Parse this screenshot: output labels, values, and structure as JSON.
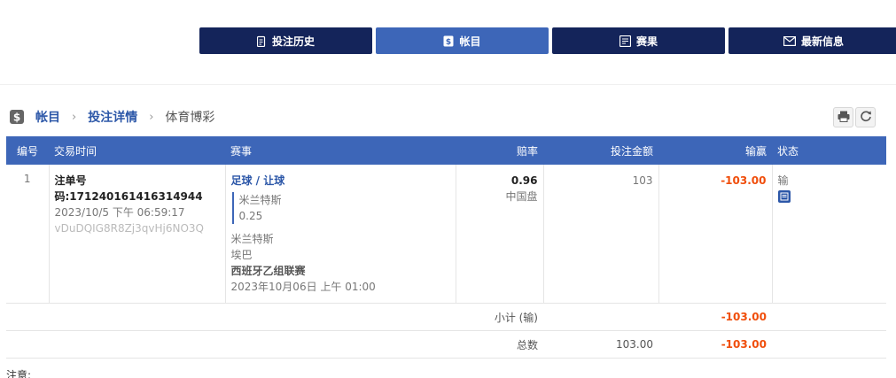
{
  "nav": [
    {
      "label": "投注历史",
      "icon": "history-icon",
      "active": false
    },
    {
      "label": "帐目",
      "icon": "ledger-icon",
      "active": true
    },
    {
      "label": "赛果",
      "icon": "results-icon",
      "active": false
    },
    {
      "label": "最新信息",
      "icon": "mail-icon",
      "active": false
    }
  ],
  "breadcrumb": {
    "account": "帐目",
    "details": "投注详情",
    "current": "体育博彩"
  },
  "table": {
    "headers": {
      "no": "编号",
      "time": "交易时间",
      "event": "赛事",
      "odds": "赔率",
      "stake": "投注金额",
      "winloss": "输赢",
      "status": "状态"
    },
    "row": {
      "no": "1",
      "ticket": "注单号码:171240161416314944",
      "datetime": "2023/10/5 下午 06:59:17",
      "ref": "vDuDQIG8R8Zj3qvHj6NO3Q",
      "sport": "足球 / 让球",
      "selection": "米兰特斯",
      "handicap": "0.25",
      "home": "米兰特斯",
      "away": "埃巴",
      "league": "西班牙乙组联赛",
      "match_time": "2023年10月06日 上午 01:00",
      "odds": "0.96",
      "odds_type": "中国盘",
      "stake": "103",
      "winloss": "-103.00",
      "status": "输"
    },
    "subtotal": {
      "label": "小计 (输)",
      "winloss": "-103.00"
    },
    "total": {
      "label": "总数",
      "stake": "103.00",
      "winloss": "-103.00"
    }
  },
  "note": "注意:",
  "colors": {
    "nav_dark": "#14245a",
    "nav_active": "#3d66b8",
    "header_bg": "#3d66b8",
    "link": "#2c57a8",
    "negative": "#f04e0b"
  }
}
